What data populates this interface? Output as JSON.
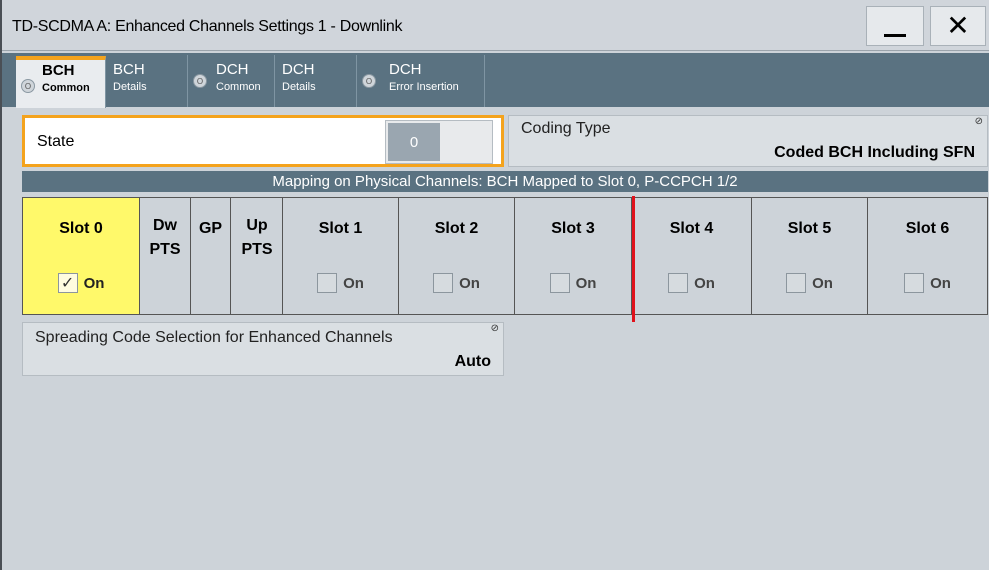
{
  "window": {
    "title": "TD-SCDMA A: Enhanced Channels Settings 1 - Downlink",
    "minimize_icon": "minimize-icon",
    "close_icon": "close-icon"
  },
  "tabs": [
    {
      "line1": "BCH",
      "line2": "Common",
      "has_led": true,
      "active": true
    },
    {
      "line1": "BCH",
      "line2": "Details",
      "has_led": false,
      "active": false
    },
    {
      "line1": "DCH",
      "line2": "Common",
      "has_led": true,
      "active": false
    },
    {
      "line1": "DCH",
      "line2": "Details",
      "has_led": false,
      "active": false
    },
    {
      "line1": "DCH",
      "line2": "Error Insertion",
      "has_led": true,
      "active": false
    }
  ],
  "state": {
    "label": "State",
    "toggle_value": "0"
  },
  "coding_type": {
    "label": "Coding Type",
    "value": "Coded BCH Including SFN"
  },
  "mapping": {
    "header": "Mapping on Physical Channels: BCH Mapped to Slot 0, P-CCPCH 1/2"
  },
  "slots": [
    {
      "label": "Slot 0",
      "checkbox_label": "On",
      "checked": true,
      "has_checkbox": true
    },
    {
      "label": "Dw PTS",
      "has_checkbox": false
    },
    {
      "label": "GP",
      "has_checkbox": false
    },
    {
      "label": "Up PTS",
      "has_checkbox": false
    },
    {
      "label": "Slot 1",
      "checkbox_label": "On",
      "checked": false,
      "has_checkbox": true
    },
    {
      "label": "Slot 2",
      "checkbox_label": "On",
      "checked": false,
      "has_checkbox": true
    },
    {
      "label": "Slot 3",
      "checkbox_label": "On",
      "checked": false,
      "has_checkbox": true
    },
    {
      "label": "Slot 4",
      "checkbox_label": "On",
      "checked": false,
      "has_checkbox": true
    },
    {
      "label": "Slot 5",
      "checkbox_label": "On",
      "checked": false,
      "has_checkbox": true
    },
    {
      "label": "Slot 6",
      "checkbox_label": "On",
      "checked": false,
      "has_checkbox": true
    }
  ],
  "spreading_code": {
    "label": "Spreading Code Selection for Enhanced Channels",
    "value": "Auto"
  },
  "colors": {
    "accent": "#f4a31d",
    "tab_bar": "#5a7281",
    "highlight_slot": "#fff96a",
    "switch_marker": "#e0111b"
  }
}
